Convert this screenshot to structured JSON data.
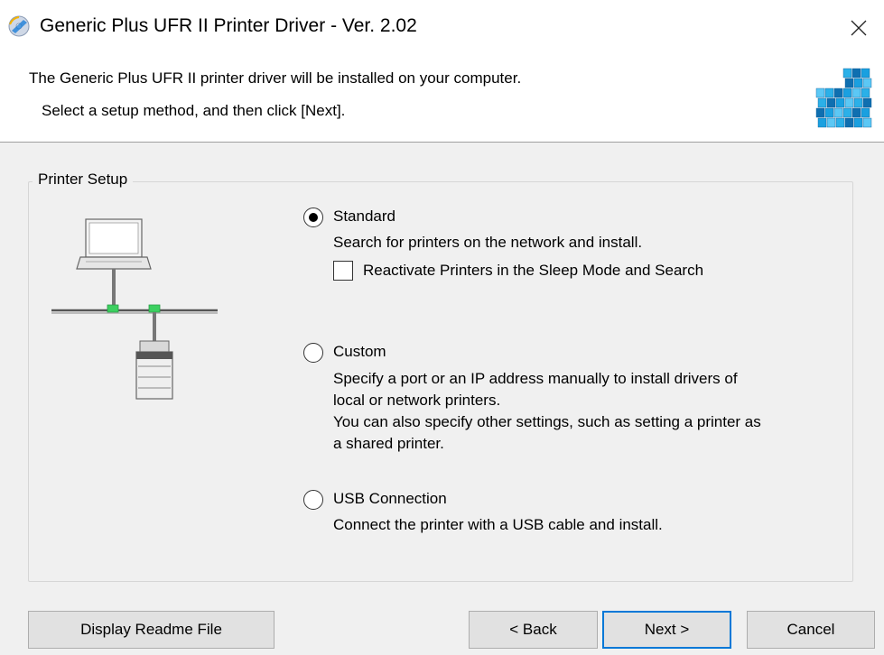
{
  "window": {
    "title": "Generic Plus UFR II Printer Driver - Ver. 2.02"
  },
  "header": {
    "line1": "The Generic Plus UFR II printer driver will be installed on your computer.",
    "line2": "Select a setup method, and then click [Next]."
  },
  "printer_setup": {
    "group_label": "Printer Setup",
    "options": [
      {
        "label": "Standard",
        "selected": true,
        "description": [
          "Search for printers on the network and install."
        ],
        "checkbox": {
          "label": "Reactivate Printers in the Sleep Mode and Search",
          "checked": false
        }
      },
      {
        "label": "Custom",
        "selected": false,
        "description": [
          "Specify a port or an IP address manually to install drivers of",
          "local or network printers.",
          "You can also specify other settings, such as setting a printer as",
          "a shared printer."
        ]
      },
      {
        "label": "USB Connection",
        "selected": false,
        "description": [
          "Connect the printer with a USB cable and install."
        ]
      }
    ]
  },
  "buttons": {
    "readme": "Display Readme File",
    "back": "< Back",
    "next": "Next >",
    "cancel": "Cancel"
  },
  "colors": {
    "default_button_border": "#0078d7",
    "network_port": "#3cd060",
    "cube_blue": "#1aa0e0"
  },
  "icons": {
    "app": "printer-cd-icon",
    "close": "close-icon",
    "header_graphic": "cube-graphic",
    "illustration": "network-illustration"
  }
}
